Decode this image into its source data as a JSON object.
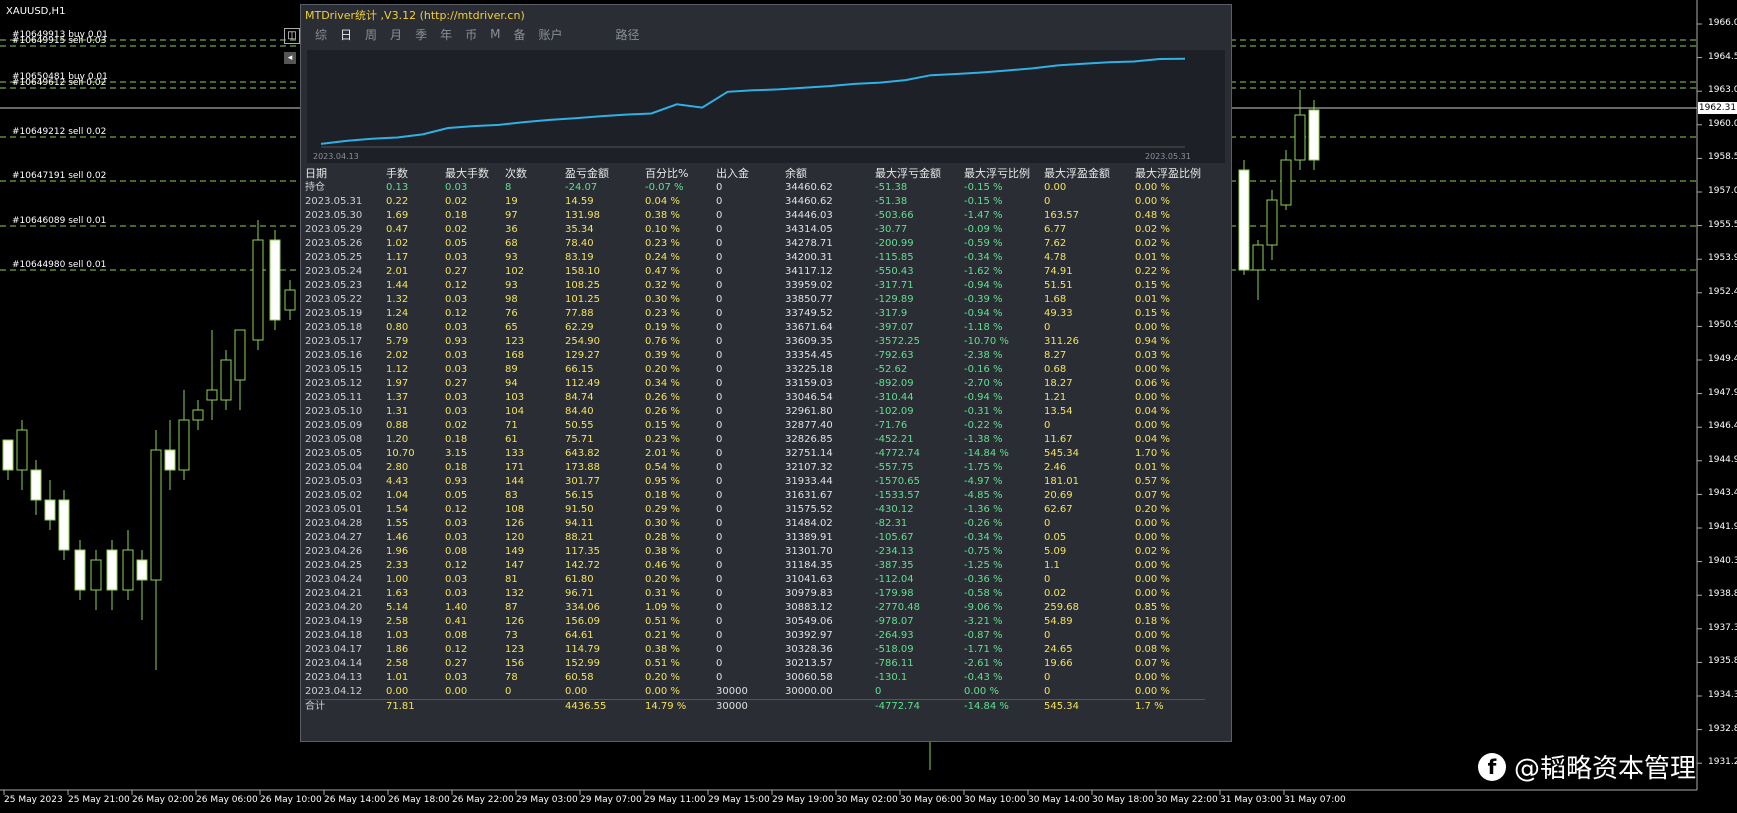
{
  "chart": {
    "symbol": "XAUUSD,H1",
    "current_price": "1962.31",
    "price_labels": [
      "1966.05",
      "1964.55",
      "1963.05",
      "1960.00",
      "1958.55",
      "1957.00",
      "1955.50",
      "1953.95",
      "1952.45",
      "1950.95",
      "1949.45",
      "1947.95",
      "1946.40",
      "1944.90",
      "1943.40",
      "1941.90",
      "1940.35",
      "1938.85",
      "1937.35",
      "1935.85",
      "1934.30",
      "1932.80",
      "1931.25"
    ],
    "time_labels": [
      "25 May 2023",
      "25 May 21:00",
      "26 May 02:00",
      "26 May 06:00",
      "26 May 10:00",
      "26 May 14:00",
      "26 May 18:00",
      "26 May 22:00",
      "29 May 03:00",
      "29 May 07:00",
      "29 May 11:00",
      "29 May 15:00",
      "29 May 19:00",
      "30 May 02:00",
      "30 May 06:00",
      "30 May 10:00",
      "30 May 14:00",
      "30 May 18:00",
      "30 May 22:00",
      "31 May 03:00",
      "31 May 07:00"
    ],
    "orders": [
      "#10649913 buy 0.01",
      "#10649915 sell 0.03",
      "#10650481 buy 0.01",
      "#10649612 sell 0.02",
      "#10649212 sell 0.02",
      "#10647191 sell 0.02",
      "#10646089 sell 0.01",
      "#10644980 sell 0.01"
    ]
  },
  "watermark": {
    "icon": "facebook-icon",
    "text": "@韬略资本管理"
  },
  "panel": {
    "title": "MTDriver统计 ,V3.12 (http://mtdriver.cn)",
    "tabs": [
      "综",
      "日",
      "周",
      "月",
      "季",
      "年",
      "币",
      "M",
      "备",
      "账户",
      "路径"
    ],
    "equity_start": "2023.04.13",
    "equity_end": "2023.05.31",
    "equity_curve": [
      30060,
      30213,
      30328,
      30392,
      30549,
      30883,
      30979,
      31041,
      31184,
      31301,
      31389,
      31484,
      31575,
      31631,
      32107,
      31933,
      32751,
      32826,
      32877,
      32961,
      33046,
      33159,
      33225,
      33354,
      33609,
      33671,
      33749,
      33850,
      33959,
      34117,
      34200,
      34278,
      34314,
      34446,
      34460
    ],
    "headers": [
      "日期",
      "手数",
      "最大手数",
      "次数",
      "盈亏金额",
      "百分比%",
      "出入金",
      "余额",
      "最大浮亏金额",
      "最大浮亏比例",
      "最大浮盈金额",
      "最大浮盈比例"
    ],
    "position_row": [
      "持仓",
      "0.13",
      "0.03",
      "8",
      "-24.07",
      "-0.07 %",
      "0",
      "34460.62",
      "-51.38",
      "-0.15 %",
      "0.00",
      "0.00 %"
    ],
    "rows": [
      [
        "2023.05.31",
        "0.22",
        "0.02",
        "19",
        "14.59",
        "0.04 %",
        "0",
        "34460.62",
        "-51.38",
        "-0.15 %",
        "0",
        "0.00 %"
      ],
      [
        "2023.05.30",
        "1.69",
        "0.18",
        "97",
        "131.98",
        "0.38 %",
        "0",
        "34446.03",
        "-503.66",
        "-1.47 %",
        "163.57",
        "0.48 %"
      ],
      [
        "2023.05.29",
        "0.47",
        "0.02",
        "36",
        "35.34",
        "0.10 %",
        "0",
        "34314.05",
        "-30.77",
        "-0.09 %",
        "6.77",
        "0.02 %"
      ],
      [
        "2023.05.26",
        "1.02",
        "0.05",
        "68",
        "78.40",
        "0.23 %",
        "0",
        "34278.71",
        "-200.99",
        "-0.59 %",
        "7.62",
        "0.02 %"
      ],
      [
        "2023.05.25",
        "1.17",
        "0.03",
        "93",
        "83.19",
        "0.24 %",
        "0",
        "34200.31",
        "-115.85",
        "-0.34 %",
        "4.78",
        "0.01 %"
      ],
      [
        "2023.05.24",
        "2.01",
        "0.27",
        "102",
        "158.10",
        "0.47 %",
        "0",
        "34117.12",
        "-550.43",
        "-1.62 %",
        "74.91",
        "0.22 %"
      ],
      [
        "2023.05.23",
        "1.44",
        "0.12",
        "93",
        "108.25",
        "0.32 %",
        "0",
        "33959.02",
        "-317.71",
        "-0.94 %",
        "51.51",
        "0.15 %"
      ],
      [
        "2023.05.22",
        "1.32",
        "0.03",
        "98",
        "101.25",
        "0.30 %",
        "0",
        "33850.77",
        "-129.89",
        "-0.39 %",
        "1.68",
        "0.01 %"
      ],
      [
        "2023.05.19",
        "1.24",
        "0.12",
        "76",
        "77.88",
        "0.23 %",
        "0",
        "33749.52",
        "-317.9",
        "-0.94 %",
        "49.33",
        "0.15 %"
      ],
      [
        "2023.05.18",
        "0.80",
        "0.03",
        "65",
        "62.29",
        "0.19 %",
        "0",
        "33671.64",
        "-397.07",
        "-1.18 %",
        "0",
        "0.00 %"
      ],
      [
        "2023.05.17",
        "5.79",
        "0.93",
        "123",
        "254.90",
        "0.76 %",
        "0",
        "33609.35",
        "-3572.25",
        "-10.70 %",
        "311.26",
        "0.94 %"
      ],
      [
        "2023.05.16",
        "2.02",
        "0.03",
        "168",
        "129.27",
        "0.39 %",
        "0",
        "33354.45",
        "-792.63",
        "-2.38 %",
        "8.27",
        "0.03 %"
      ],
      [
        "2023.05.15",
        "1.12",
        "0.03",
        "89",
        "66.15",
        "0.20 %",
        "0",
        "33225.18",
        "-52.62",
        "-0.16 %",
        "0.68",
        "0.00 %"
      ],
      [
        "2023.05.12",
        "1.97",
        "0.27",
        "94",
        "112.49",
        "0.34 %",
        "0",
        "33159.03",
        "-892.09",
        "-2.70 %",
        "18.27",
        "0.06 %"
      ],
      [
        "2023.05.11",
        "1.37",
        "0.03",
        "103",
        "84.74",
        "0.26 %",
        "0",
        "33046.54",
        "-310.44",
        "-0.94 %",
        "1.21",
        "0.00 %"
      ],
      [
        "2023.05.10",
        "1.31",
        "0.03",
        "104",
        "84.40",
        "0.26 %",
        "0",
        "32961.80",
        "-102.09",
        "-0.31 %",
        "13.54",
        "0.04 %"
      ],
      [
        "2023.05.09",
        "0.88",
        "0.02",
        "71",
        "50.55",
        "0.15 %",
        "0",
        "32877.40",
        "-71.76",
        "-0.22 %",
        "0",
        "0.00 %"
      ],
      [
        "2023.05.08",
        "1.20",
        "0.18",
        "61",
        "75.71",
        "0.23 %",
        "0",
        "32826.85",
        "-452.21",
        "-1.38 %",
        "11.67",
        "0.04 %"
      ],
      [
        "2023.05.05",
        "10.70",
        "3.15",
        "133",
        "643.82",
        "2.01 %",
        "0",
        "32751.14",
        "-4772.74",
        "-14.84 %",
        "545.34",
        "1.70 %"
      ],
      [
        "2023.05.04",
        "2.80",
        "0.18",
        "171",
        "173.88",
        "0.54 %",
        "0",
        "32107.32",
        "-557.75",
        "-1.75 %",
        "2.46",
        "0.01 %"
      ],
      [
        "2023.05.03",
        "4.43",
        "0.93",
        "144",
        "301.77",
        "0.95 %",
        "0",
        "31933.44",
        "-1570.65",
        "-4.97 %",
        "181.01",
        "0.57 %"
      ],
      [
        "2023.05.02",
        "1.04",
        "0.05",
        "83",
        "56.15",
        "0.18 %",
        "0",
        "31631.67",
        "-1533.57",
        "-4.85 %",
        "20.69",
        "0.07 %"
      ],
      [
        "2023.05.01",
        "1.54",
        "0.12",
        "108",
        "91.50",
        "0.29 %",
        "0",
        "31575.52",
        "-430.12",
        "-1.36 %",
        "62.67",
        "0.20 %"
      ],
      [
        "2023.04.28",
        "1.55",
        "0.03",
        "126",
        "94.11",
        "0.30 %",
        "0",
        "31484.02",
        "-82.31",
        "-0.26 %",
        "0",
        "0.00 %"
      ],
      [
        "2023.04.27",
        "1.46",
        "0.03",
        "120",
        "88.21",
        "0.28 %",
        "0",
        "31389.91",
        "-105.67",
        "-0.34 %",
        "0.05",
        "0.00 %"
      ],
      [
        "2023.04.26",
        "1.96",
        "0.08",
        "149",
        "117.35",
        "0.38 %",
        "0",
        "31301.70",
        "-234.13",
        "-0.75 %",
        "5.09",
        "0.02 %"
      ],
      [
        "2023.04.25",
        "2.33",
        "0.12",
        "147",
        "142.72",
        "0.46 %",
        "0",
        "31184.35",
        "-387.35",
        "-1.25 %",
        "1.1",
        "0.00 %"
      ],
      [
        "2023.04.24",
        "1.00",
        "0.03",
        "81",
        "61.80",
        "0.20 %",
        "0",
        "31041.63",
        "-112.04",
        "-0.36 %",
        "0",
        "0.00 %"
      ],
      [
        "2023.04.21",
        "1.63",
        "0.03",
        "132",
        "96.71",
        "0.31 %",
        "0",
        "30979.83",
        "-179.98",
        "-0.58 %",
        "0.02",
        "0.00 %"
      ],
      [
        "2023.04.20",
        "5.14",
        "1.40",
        "87",
        "334.06",
        "1.09 %",
        "0",
        "30883.12",
        "-2770.48",
        "-9.06 %",
        "259.68",
        "0.85 %"
      ],
      [
        "2023.04.19",
        "2.58",
        "0.41",
        "126",
        "156.09",
        "0.51 %",
        "0",
        "30549.06",
        "-978.07",
        "-3.21 %",
        "54.89",
        "0.18 %"
      ],
      [
        "2023.04.18",
        "1.03",
        "0.08",
        "73",
        "64.61",
        "0.21 %",
        "0",
        "30392.97",
        "-264.93",
        "-0.87 %",
        "0",
        "0.00 %"
      ],
      [
        "2023.04.17",
        "1.86",
        "0.12",
        "123",
        "114.79",
        "0.38 %",
        "0",
        "30328.36",
        "-518.09",
        "-1.71 %",
        "24.65",
        "0.08 %"
      ],
      [
        "2023.04.14",
        "2.58",
        "0.27",
        "156",
        "152.99",
        "0.51 %",
        "0",
        "30213.57",
        "-786.11",
        "-2.61 %",
        "19.66",
        "0.07 %"
      ],
      [
        "2023.04.13",
        "1.01",
        "0.03",
        "78",
        "60.58",
        "0.20 %",
        "0",
        "30060.58",
        "-130.1",
        "-0.43 %",
        "0",
        "0.00 %"
      ],
      [
        "2023.04.12",
        "0.00",
        "0.00",
        "0",
        "0.00",
        "0.00 %",
        "30000",
        "30000.00",
        "0",
        "0.00 %",
        "0",
        "0.00 %"
      ]
    ],
    "total_row": [
      "合计",
      "71.81",
      "",
      "",
      "4436.55",
      "14.79 %",
      "30000",
      "",
      "-4772.74",
      "-14.84 %",
      "545.34",
      "1.7 %"
    ]
  }
}
